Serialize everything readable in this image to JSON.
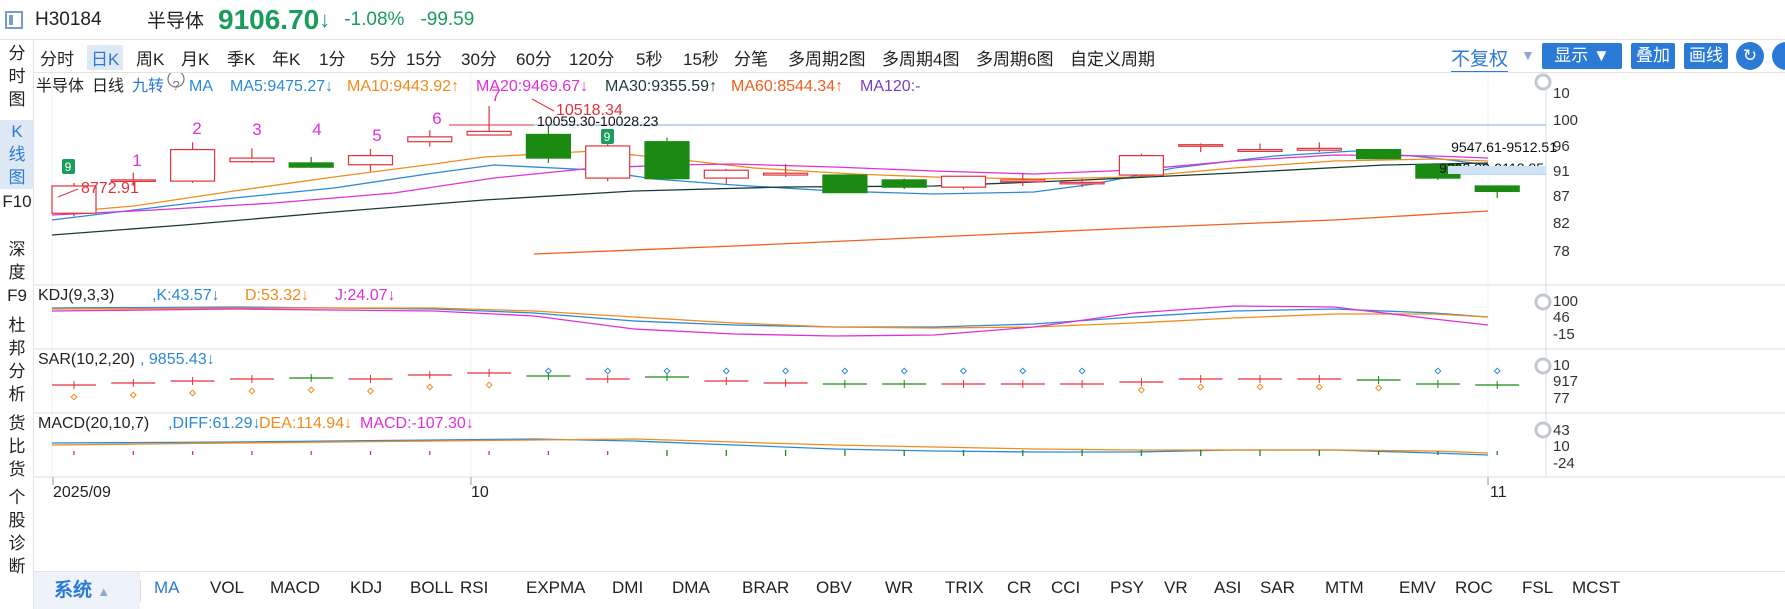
{
  "header": {
    "code": "H30184",
    "name": "半导体",
    "price": "9106.70",
    "arrow": "↓",
    "pct": "-1.08%",
    "change": "-99.59"
  },
  "sidebar": [
    "分时图",
    "K线图",
    "F10",
    "深度F9",
    "杜邦分析",
    "货比货",
    "个股诊断"
  ],
  "tabs": [
    "分时",
    "日K",
    "周K",
    "月K",
    "季K",
    "年K",
    "1分",
    "5分",
    "15分",
    "30分",
    "60分",
    "120分",
    "5秒",
    "15秒",
    "分笔",
    "多周期2图",
    "多周期4图",
    "多周期6图",
    "自定义周期"
  ],
  "active_tab": "日K",
  "toolbar": {
    "fq": "不复权",
    "display": "显示",
    "overlay": "叠加",
    "draw": "画线"
  },
  "icons": {
    "refresh": "refresh-icon",
    "dropdown": "chevron-down-icon",
    "gear": "gear-icon",
    "help": "help-circle-icon",
    "window": "window-icon"
  },
  "colors": {
    "up": "#e0333a",
    "down": "#1a8a12",
    "ma5": "#2b8ad6",
    "ma10": "#f08c1c",
    "ma20": "#e030d8",
    "ma30": "#1c3a3a",
    "ma60": "#f06020",
    "ma120": "#7a40c0",
    "accent": "#2b7ad6",
    "green": "#1a9c5a"
  },
  "kline_legend": {
    "name": "半导体",
    "period": "日线",
    "jiuzhuan": "九转",
    "ma": "MA",
    "ma5": "MA5:9475.27",
    "ma10": "MA10:9443.92",
    "ma20": "MA20:9469.67",
    "ma30": "MA30:9355.59",
    "ma60": "MA60:8544.34",
    "ma120": "MA120:-",
    "arrows": {
      "ma5": "↓",
      "ma10": "↑",
      "ma20": "↓",
      "ma30": "↑",
      "ma60": "↑",
      "ma120": "↑"
    }
  },
  "kline_axis": [
    "10",
    "100",
    "96",
    "91",
    "87",
    "82",
    "78"
  ],
  "kline_annotations": {
    "low": "8772.91",
    "high": "10518.34",
    "range1": "10059.30-10028.23",
    "range2": "9547.61-9512.51",
    "range3": "9202.98-9118.85"
  },
  "jiuzhuan_marks": [
    "9",
    "1",
    "2",
    "3",
    "4",
    "5",
    "6",
    "7",
    "9"
  ],
  "kdj_legend": {
    "name": "KDJ(9,3,3)",
    "k": "K:43.57",
    "d": "D:53.32",
    "j": "J:24.07",
    "arrows": "↓"
  },
  "kdj_axis": [
    "100",
    "46",
    "-15"
  ],
  "sar_legend": {
    "name": "SAR(10,2,20)",
    "v": "9855.43",
    "arrow": "↓"
  },
  "sar_axis": [
    "10",
    "917",
    "77"
  ],
  "macd_legend": {
    "name": "MACD(20,10,7)",
    "diff": "DIFF:61.29",
    "dea": "DEA:114.94",
    "macd": "MACD:-107.30",
    "arrow": "↓"
  },
  "macd_axis": [
    "43",
    "10",
    "-24"
  ],
  "xaxis": [
    "2025/09",
    "10",
    "11"
  ],
  "indicators": [
    "MA",
    "VOL",
    "MACD",
    "KDJ",
    "BOLL",
    "RSI",
    "EXPMA",
    "DMI",
    "DMA",
    "BRAR",
    "OBV",
    "WR",
    "TRIX",
    "CR",
    "CCI",
    "PSY",
    "VR",
    "ASI",
    "SAR",
    "MTM",
    "EMV",
    "ROC",
    "FSL",
    "MCST"
  ],
  "system_label": "系统",
  "chart_data": [
    {
      "type": "candlestick",
      "title": "半导体 日线",
      "candles": [
        {
          "o": 8750,
          "c": 9200,
          "h": 9250,
          "l": 8700
        },
        {
          "o": 9300,
          "c": 9300,
          "h": 9420,
          "l": 9200
        },
        {
          "o": 9280,
          "c": 9800,
          "h": 9920,
          "l": 9250
        },
        {
          "o": 9600,
          "c": 9660,
          "h": 9820,
          "l": 9580
        },
        {
          "o": 9580,
          "c": 9510,
          "h": 9680,
          "l": 9500
        },
        {
          "o": 9550,
          "c": 9700,
          "h": 9810,
          "l": 9440
        },
        {
          "o": 9930,
          "c": 10010,
          "h": 10120,
          "l": 9850
        },
        {
          "o": 10040,
          "c": 10100,
          "h": 10518,
          "l": 10030
        },
        {
          "o": 10050,
          "c": 9660,
          "h": 10200,
          "l": 9580
        },
        {
          "o": 9330,
          "c": 9860,
          "h": 9950,
          "l": 9280
        },
        {
          "o": 9930,
          "c": 9320,
          "h": 10000,
          "l": 9300
        },
        {
          "o": 9330,
          "c": 9460,
          "h": 9480,
          "l": 9240
        },
        {
          "o": 9380,
          "c": 9410,
          "h": 9560,
          "l": 9350
        },
        {
          "o": 9380,
          "c": 9090,
          "h": 9380,
          "l": 9090
        },
        {
          "o": 9300,
          "c": 9180,
          "h": 9320,
          "l": 9150
        },
        {
          "o": 9180,
          "c": 9360,
          "h": 9370,
          "l": 9140
        },
        {
          "o": 9270,
          "c": 9300,
          "h": 9400,
          "l": 9200
        },
        {
          "o": 9250,
          "c": 9260,
          "h": 9320,
          "l": 9180
        },
        {
          "o": 9380,
          "c": 9700,
          "h": 9730,
          "l": 9360
        },
        {
          "o": 9880,
          "c": 9880,
          "h": 9900,
          "l": 9760
        },
        {
          "o": 9770,
          "c": 9800,
          "h": 9900,
          "l": 9760
        },
        {
          "o": 9790,
          "c": 9820,
          "h": 9920,
          "l": 9760
        },
        {
          "o": 9800,
          "c": 9650,
          "h": 9800,
          "l": 9640
        },
        {
          "o": 9550,
          "c": 9330,
          "h": 9550,
          "l": 9300
        },
        {
          "o": 9200,
          "c": 9110,
          "h": 9210,
          "l": 9000
        }
      ]
    }
  ]
}
